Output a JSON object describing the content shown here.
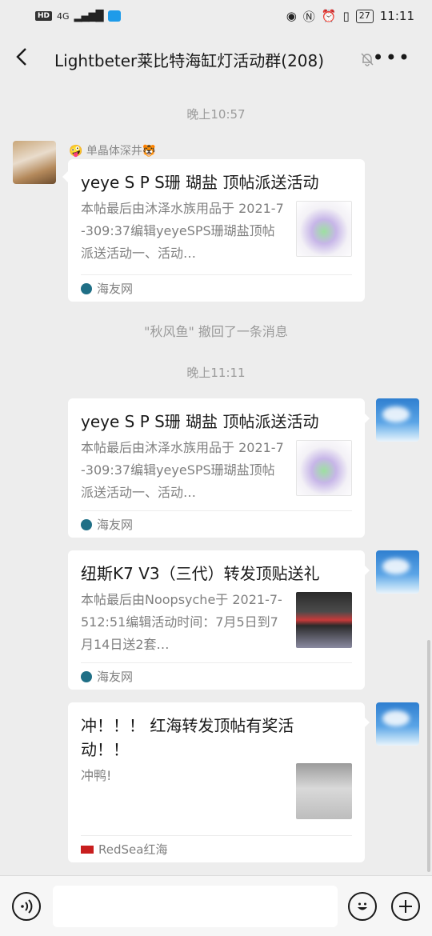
{
  "status_bar": {
    "network": "HD",
    "signal_label": "4G",
    "time": "11:11",
    "battery": "27"
  },
  "header": {
    "back_icon": "chevron-left-icon",
    "title": "Lightbeter莱比特海缸灯活动群(208)",
    "mute_icon": "bell-off-icon",
    "more_icon": "more-dots-icon",
    "more_glyph": "•••"
  },
  "messages": {
    "time1": "晚上10:57",
    "msg1": {
      "sender": "🤪 单晶体深井🐯",
      "title": "yeye S P S珊 瑚盐 顶帖派送活动",
      "desc": "本帖最后由沐泽水族用品于 2021-7-309:37编辑yeyeSPS珊瑚盐顶帖派送活动一、活动…",
      "source": "海友网"
    },
    "recall": "\"秋风鱼\" 撤回了一条消息",
    "time2": "晚上11:11",
    "msg2": {
      "title": "yeye S P S珊 瑚盐 顶帖派送活动",
      "desc": "本帖最后由沐泽水族用品于 2021-7-309:37编辑yeyeSPS珊瑚盐顶帖派送活动一、活动…",
      "source": "海友网"
    },
    "msg3": {
      "title": "纽斯K7 V3（三代）转发顶贴送礼",
      "desc": "本帖最后由Noopsyche于 2021-7-512:51编辑活动时间：7月5日到7月14日送2套…",
      "source": "海友网"
    },
    "msg4": {
      "title": "冲！！！ 红海转发顶帖有奖活动！！",
      "desc": "冲鸭!",
      "source": "RedSea红海"
    }
  },
  "input_bar": {
    "voice_glyph": "◉",
    "emoji_glyph": "☺",
    "plus_glyph": "+"
  }
}
